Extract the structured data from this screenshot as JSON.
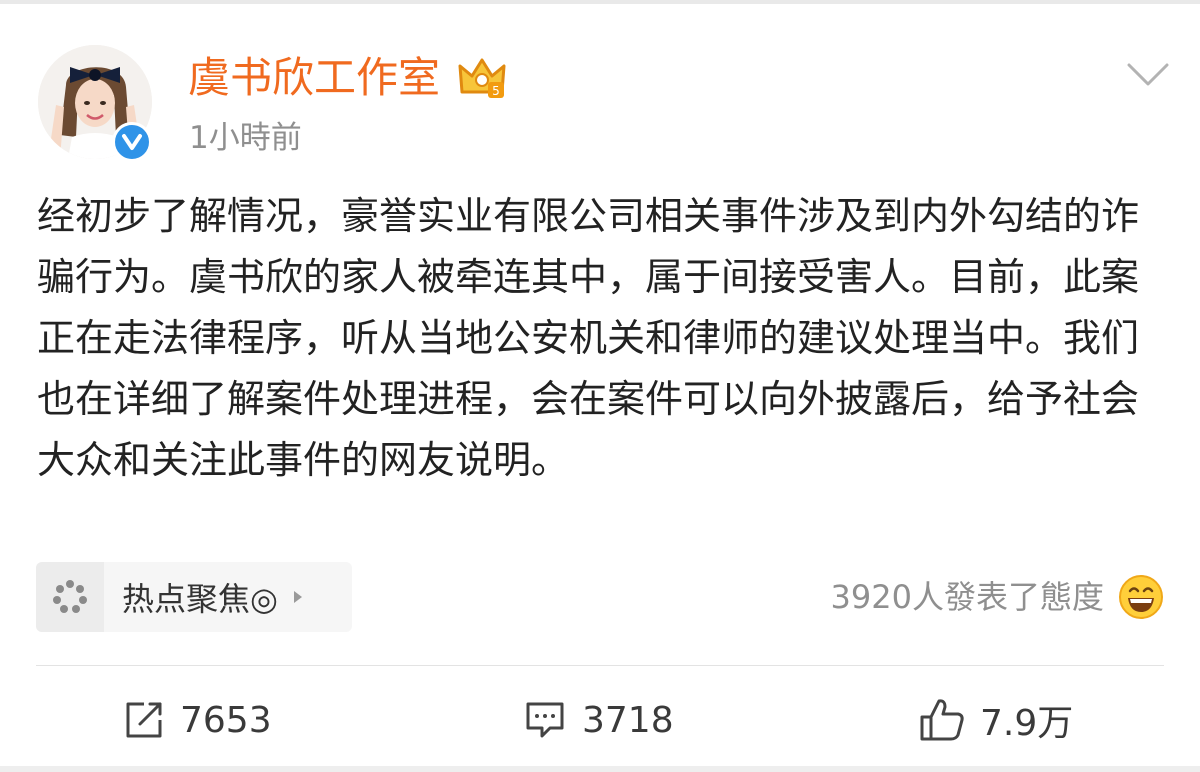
{
  "post": {
    "author": "虞书欣工作室",
    "timestamp": "1小時前",
    "text": "经初步了解情况，豪誉实业有限公司相关事件涉及到内外勾结的诈骗行为。虞书欣的家人被牵连其中，属于间接受害人。目前，此案正在走法律程序，听从当地公安机关和律师的建议处理当中。我们也在详细了解案件处理进程，会在案件可以向外披露后，给予社会大众和关注此事件的网友说明。",
    "topic_label": "热点聚焦◎",
    "attitude_text": "3920人發表了態度"
  },
  "actions": {
    "repost_count": "7653",
    "comment_count": "3718",
    "like_count": "7.9万"
  },
  "icons": {
    "avatar": "avatar-photo",
    "verified": "verified-badge-icon",
    "crown": "crown-vip-icon",
    "chevron": "chevron-down-icon",
    "topic": "topic-spinner-icon",
    "topic_arrow": "triangle-right-icon",
    "emoji": "grinning-emoji-icon",
    "repost": "repost-icon",
    "comment": "comment-icon",
    "like": "thumbs-up-icon"
  },
  "colors": {
    "username": "#f06a1f",
    "verified": "#2f93e8",
    "crown": "#f2a516",
    "muted": "#8f8f8f",
    "text": "#222222"
  }
}
